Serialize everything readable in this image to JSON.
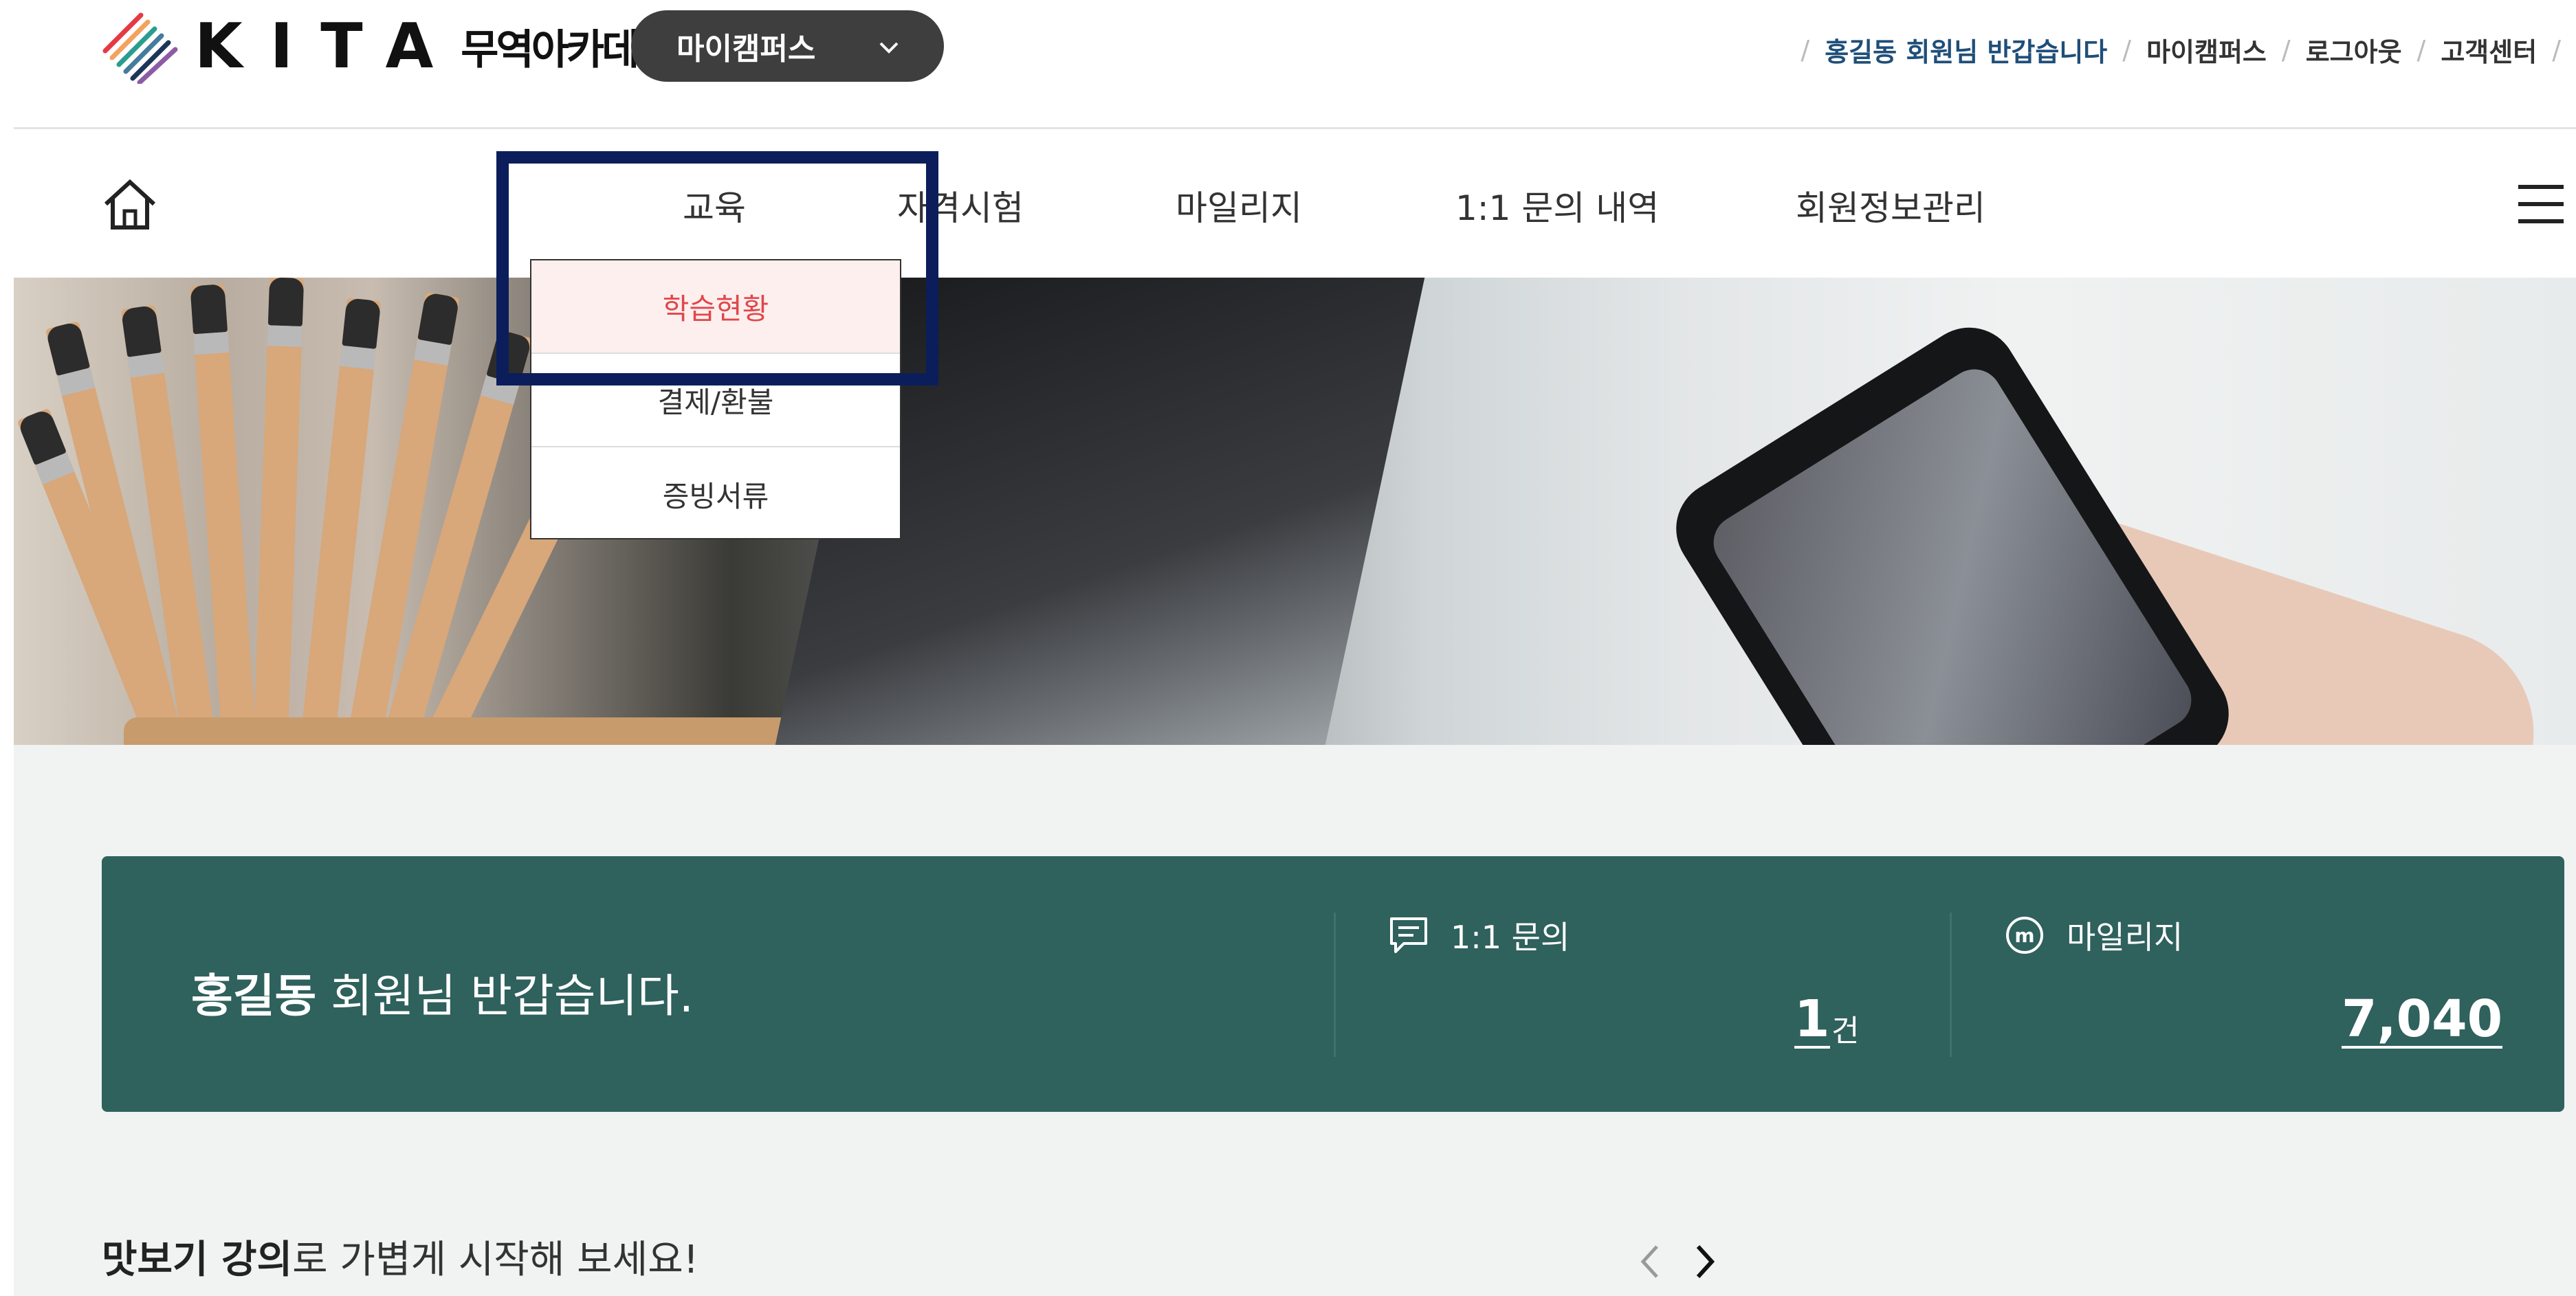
{
  "brand": {
    "logo_text": "KITA",
    "logo_sub": "무역아카데미"
  },
  "campus_switcher": {
    "label": "마이캠퍼스"
  },
  "util_nav": {
    "greeting": "홍길동 회원님 반갑습니다",
    "links": [
      "마이캠퍼스",
      "로그아웃",
      "고객센터"
    ]
  },
  "main_nav": {
    "items": [
      "교육",
      "자격시험",
      "마일리지",
      "1:1 문의 내역",
      "회원정보관리"
    ]
  },
  "dropdown": {
    "items": [
      "학습현황",
      "결제/환불",
      "증빙서류"
    ],
    "active_index": 0
  },
  "welcome": {
    "name": "홍길동",
    "message": "회원님 반갑습니다.",
    "inquiry_label": "1:1 문의",
    "inquiry_count": "1",
    "inquiry_unit": "건",
    "mileage_label": "마일리지",
    "mileage_value": "7,040"
  },
  "teaser": {
    "bold": "맛보기 강의",
    "rest": "로 가볍게 시작해 보세요!"
  },
  "colors": {
    "welcome_bg": "#2f615d",
    "active_red": "#e2464a",
    "highlight_border": "#0b1e5b",
    "util_greeting": "#1f4e79"
  }
}
